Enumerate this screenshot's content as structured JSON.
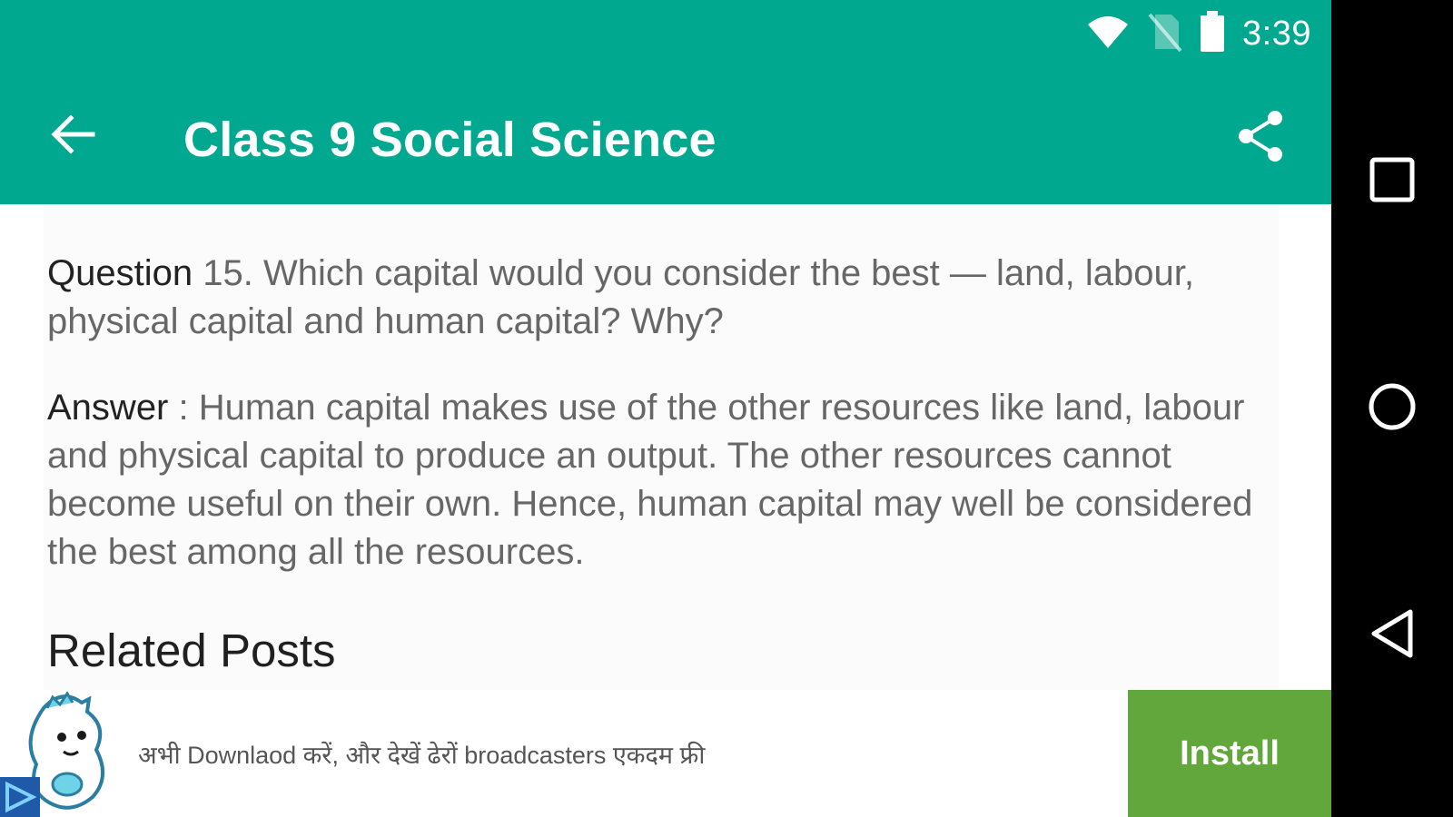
{
  "status_bar": {
    "time": "3:39",
    "icons": [
      "wifi-icon",
      "no-sim-icon",
      "battery-icon"
    ]
  },
  "app_bar": {
    "title": "Class 9 Social Science",
    "back_icon": "arrow-left-icon",
    "share_icon": "share-icon"
  },
  "article": {
    "question_label": "Question",
    "question_text": " 15. Which capital would you consider the best — land, labour, physical capital and human capital? Why?",
    "answer_label": "Answer",
    "answer_text": " : Human capital makes use of the other resources like land, labour and physical capital to produce an output. The other resources cannot become useful on their own. Hence, human capital may well be considered the best among all the resources.",
    "related_heading": "Related Posts"
  },
  "ad": {
    "text": "अभी Downlaod करें, और देखें ढेरों broadcasters एकदम फ्री",
    "install_label": "Install"
  },
  "navigation_bar": {
    "icons": [
      "recent-apps-icon",
      "home-icon",
      "back-icon"
    ]
  },
  "colors": {
    "primary": "#00A88F",
    "install": "#62A73C",
    "navbar": "#000000"
  }
}
